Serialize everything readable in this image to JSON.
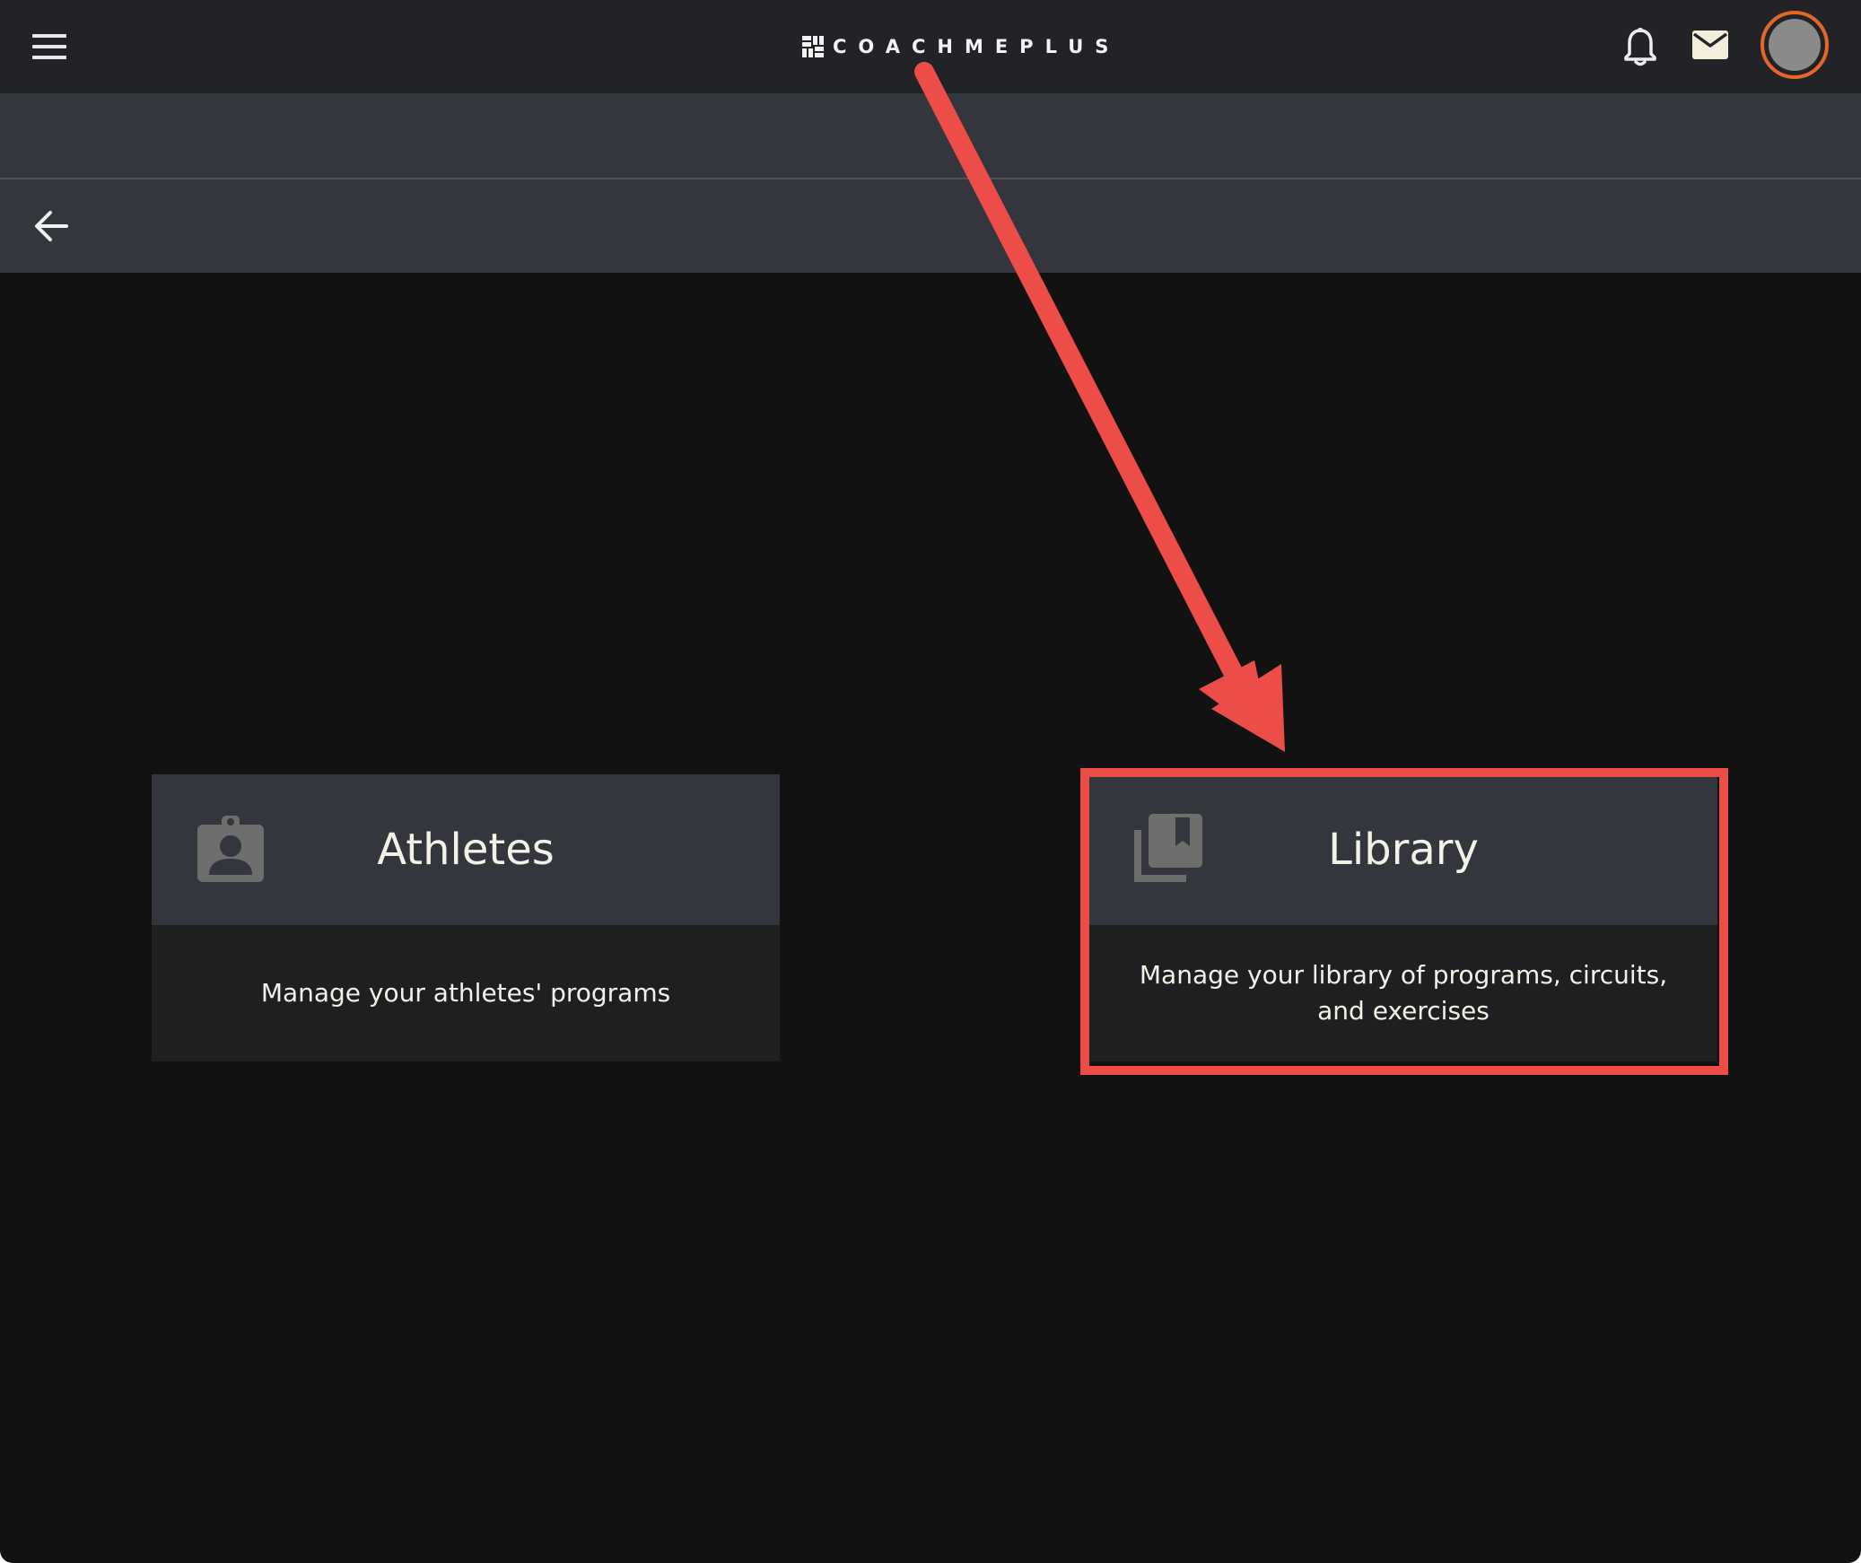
{
  "app": {
    "brand_name": "COACHMEPLUS"
  },
  "header": {
    "menu_icon": "hamburger-menu-icon",
    "notifications_icon": "bell-icon",
    "messages_icon": "envelope-icon",
    "avatar_ring_color": "#e8652a"
  },
  "subheader": {
    "back_icon": "arrow-left-icon"
  },
  "cards": [
    {
      "title": "Athletes",
      "description": "Manage your athletes' programs",
      "icon": "assignment-ind-icon"
    },
    {
      "title": "Library",
      "description": "Manage your library of programs, circuits, and exercises",
      "icon": "library-books-icon"
    }
  ],
  "annotation": {
    "color": "#ec4e47",
    "highlighted_card": "Library"
  },
  "colors": {
    "topbar": "#222326",
    "subheader": "#33363c",
    "background": "#121212",
    "card_body": "#1e1f21",
    "text": "#f4f1e8"
  }
}
